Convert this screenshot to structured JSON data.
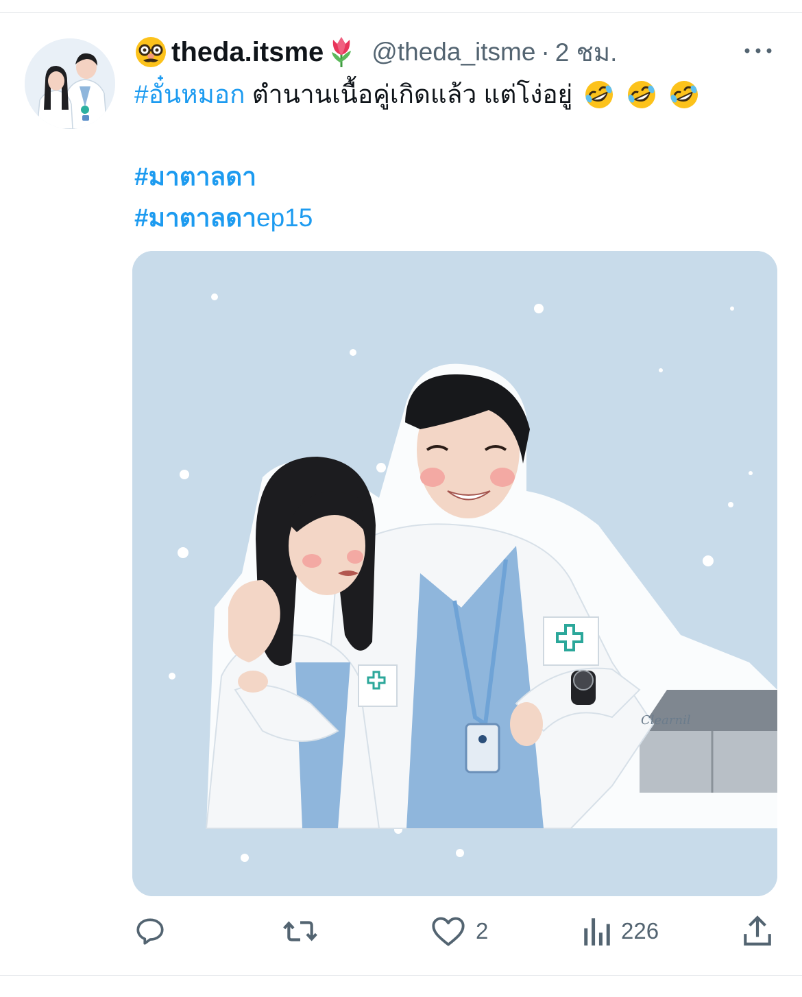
{
  "tweet": {
    "display_name": "theda.itsme",
    "handle": "@theda_itsme",
    "separator": "·",
    "time": "2 ชม.",
    "hashtag_main": "#อั๋นหมอก",
    "text_main": " ตำนานเนื้อคู่เกิดแล้ว แต่โง่อยู่",
    "hashtag_1": "#มาตาลดา",
    "hashtag_2_bold": "#มาตาลดา",
    "hashtag_2_rest": "ep15",
    "image_signature": "Clearnil"
  },
  "actions": {
    "reply_count": "",
    "retweet_count": "",
    "like_count": "2",
    "views_count": "226"
  },
  "icons": {
    "display_emoji": "disguised-face-emoji",
    "name_emoji": "tulip-emoji",
    "text_emoji": "rolling-on-floor-laughing-emoji"
  },
  "colors": {
    "link": "#1d9bf0",
    "secondary_text": "#536471",
    "image_background": "#c8dbea"
  }
}
